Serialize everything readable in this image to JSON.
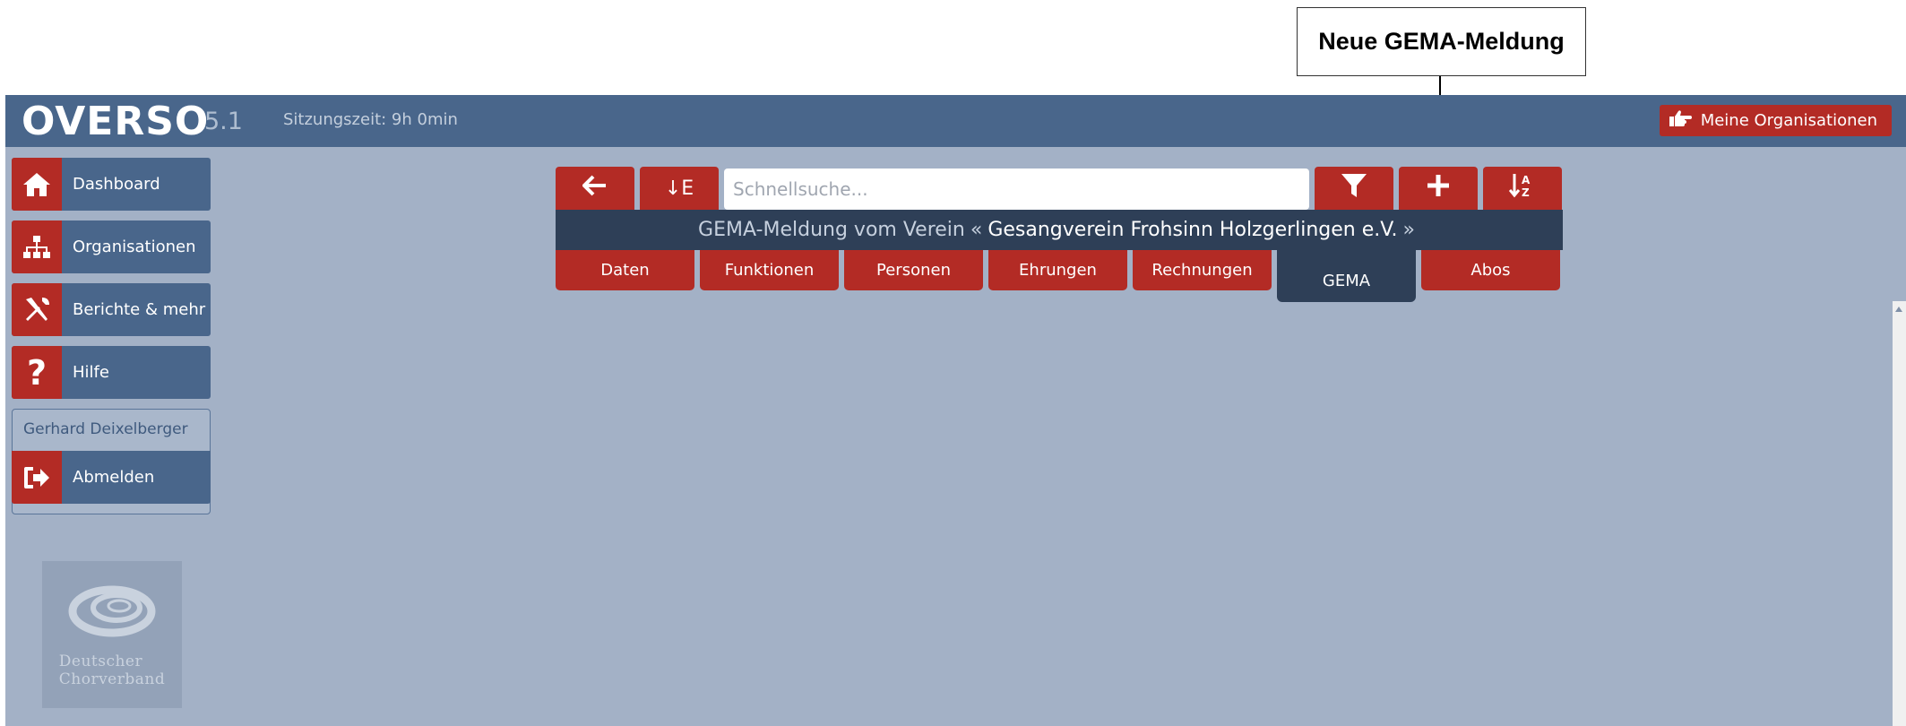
{
  "callout": {
    "label": "Neue GEMA-Meldung"
  },
  "header": {
    "logo": "OVERSO",
    "version": "5.1",
    "session": "Sitzungszeit: 9h 0min",
    "orgs_button": "Meine Organisationen"
  },
  "sidebar": {
    "items": [
      {
        "label": "Dashboard",
        "icon": "home-icon"
      },
      {
        "label": "Organisationen",
        "icon": "sitemap-icon"
      },
      {
        "label": "Berichte & mehr",
        "icon": "tools-icon"
      },
      {
        "label": "Hilfe",
        "icon": "question-icon"
      }
    ],
    "user_name": "Gerhard Deixelberger",
    "logout_label": "Abmelden",
    "logo_lines": [
      "Deutscher",
      "Chorverband"
    ]
  },
  "toolbar": {
    "back_icon": "arrow-left-icon",
    "sort_e_label": "↓E",
    "search_placeholder": "Schnellsuche...",
    "filter_icon": "filter-icon",
    "add_icon": "plus-icon",
    "sort_az_icon": "sort-az-icon"
  },
  "title": {
    "prefix": "GEMA-Meldung vom Verein",
    "open_quote": "«",
    "name": "Gesangverein Frohsinn Holzgerlingen e.V.",
    "close_quote": "»"
  },
  "tabs": [
    "Daten",
    "Funktionen",
    "Personen",
    "Ehrungen",
    "Rechnungen",
    "GEMA",
    "Abos"
  ],
  "active_tab": "GEMA",
  "colors": {
    "header": "#49668b",
    "accent": "#b32b25",
    "background": "#a3b1c6",
    "dark": "#2e3f57"
  }
}
